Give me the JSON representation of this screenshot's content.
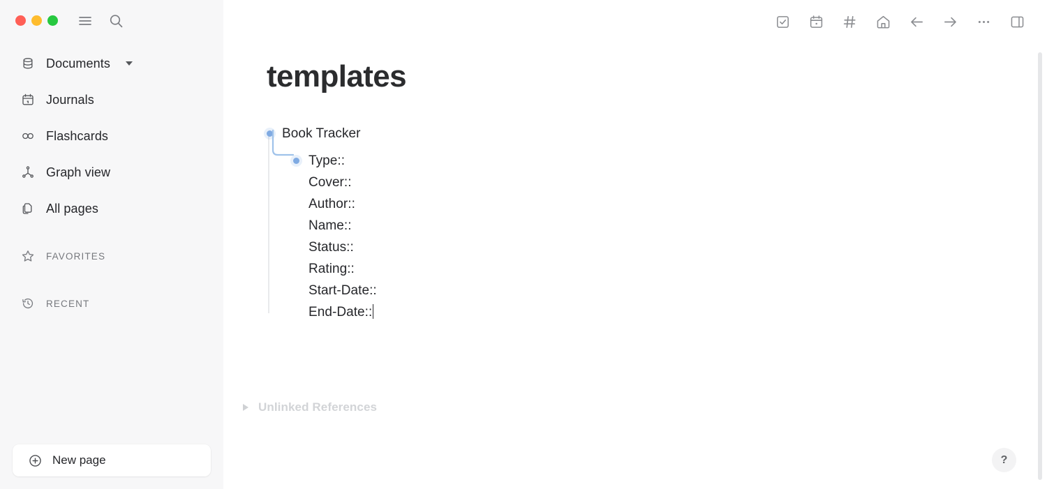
{
  "window": {
    "controls": [
      {
        "name": "close",
        "color": "#ff5f56"
      },
      {
        "name": "minimize",
        "color": "#febc2e"
      },
      {
        "name": "maximize",
        "color": "#27c840"
      }
    ],
    "menu_icon": "hamburger-menu-icon",
    "search_icon": "search-icon"
  },
  "sidebar": {
    "items": [
      {
        "label": "Documents",
        "icon": "database-icon",
        "has_caret": true
      },
      {
        "label": "Journals",
        "icon": "calendar-icon",
        "has_caret": false
      },
      {
        "label": "Flashcards",
        "icon": "infinity-icon",
        "has_caret": false
      },
      {
        "label": "Graph view",
        "icon": "graph-icon",
        "has_caret": false
      },
      {
        "label": "All pages",
        "icon": "pages-icon",
        "has_caret": false
      }
    ],
    "sections": [
      {
        "label": "FAVORITES",
        "icon": "star-icon"
      },
      {
        "label": "RECENT",
        "icon": "history-clock-icon"
      }
    ],
    "new_page_label": "New page",
    "new_page_icon": "plus-circle-icon",
    "background_color": "#f7f7f8"
  },
  "toolbar": {
    "buttons": [
      {
        "name": "todo-checkbox-icon",
        "title": "Todo"
      },
      {
        "name": "calendar-icon",
        "title": "Journal"
      },
      {
        "name": "hash-tag-icon",
        "title": "Tags"
      },
      {
        "name": "home-icon",
        "title": "Home"
      },
      {
        "name": "arrow-left-icon",
        "title": "Back"
      },
      {
        "name": "arrow-right-icon",
        "title": "Forward"
      },
      {
        "name": "more-dots-icon",
        "title": "More"
      },
      {
        "name": "right-sidebar-toggle-icon",
        "title": "Toggle right sidebar"
      }
    ]
  },
  "page": {
    "title": "templates",
    "parent_block": "Book Tracker",
    "child_lines": [
      "Type::",
      "Cover::",
      "Author::",
      "Name::",
      "Status::",
      "Rating::",
      "Start-Date::",
      "End-Date::"
    ],
    "cursor_after_line_index": 7,
    "unlinked_references_label": "Unlinked References",
    "bullet_color": "#7faae2",
    "title_color": "#2b2c2e"
  },
  "help": {
    "label": "?"
  }
}
